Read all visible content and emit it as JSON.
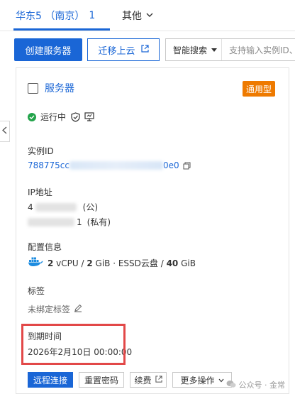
{
  "tabs": {
    "region": "华东5 （南京）",
    "region_count": "1",
    "other": "其他"
  },
  "toolbar": {
    "create_label": "创建服务器",
    "migrate_label": "迁移上云",
    "search_type": "智能搜索",
    "search_placeholder": "支持输入实例ID、"
  },
  "card": {
    "title": "服务器",
    "badge": "通用型",
    "status": "运行中",
    "instance_id_label": "实例ID",
    "instance_id_prefix": "788775cc",
    "instance_id_suffix": "0e0",
    "ip_label": "IP地址",
    "ip_public_prefix": "4",
    "ip_public_tag": "(公)",
    "ip_private_suffix": "1",
    "ip_private_tag": "(私有)",
    "config_label": "配置信息",
    "config_cpu": "2",
    "config_cpu_unit": " vCPU / ",
    "config_mem": "2",
    "config_mem_unit": " GiB · ESSD云盘 / ",
    "config_disk": "40",
    "config_disk_unit": " GiB",
    "tags_label": "标签",
    "tags_value": "未绑定标签",
    "expire_label": "到期时间",
    "expire_value": "2026年2月10日 00:00:00"
  },
  "actions": {
    "remote": "远程连接",
    "reset_password": "重置密码",
    "renew": "续费",
    "more": "更多操作"
  },
  "watermark": "公众号 · 金常"
}
